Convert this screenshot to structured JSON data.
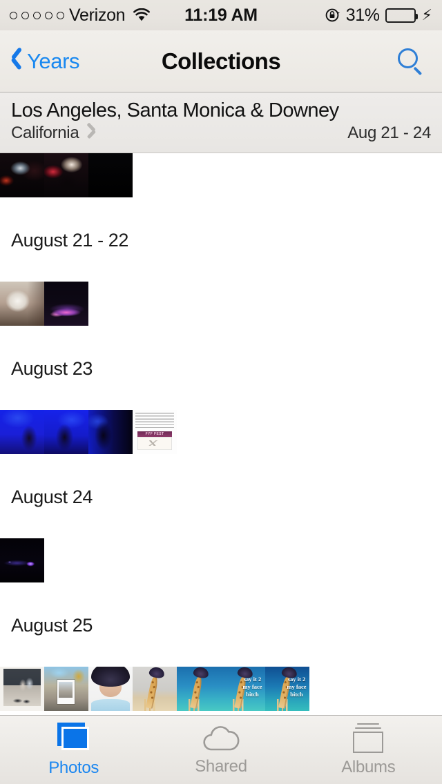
{
  "status_bar": {
    "signal_dots": 5,
    "carrier": "Verizon",
    "wifi_icon": "wifi-icon",
    "time": "11:19 AM",
    "rotation_lock_icon": "rotation-lock-icon",
    "battery_percent": "31%",
    "battery_fill_ratio": 0.31,
    "battery_color": "#4cd45e",
    "charging_icon": "lightning-bolt-icon"
  },
  "nav_bar": {
    "back_label": "Years",
    "back_icon": "chevron-left-icon",
    "title": "Collections",
    "search_icon": "search-icon",
    "accent_color": "#1988f0"
  },
  "collection_header": {
    "title": "Los Angeles, Santa Monica & Downey",
    "subtitle": "California",
    "disclosure_icon": "chevron-right-icon",
    "date_range": "Aug 21 - 24"
  },
  "sections": [
    {
      "heading": null,
      "clipped": true,
      "photos": [
        {
          "name": "concert-crowd-screen",
          "art": "ph-concert-a"
        },
        {
          "name": "concert-silhouette",
          "art": "ph-concert-b"
        },
        {
          "name": "black-frame",
          "art": "ph-black"
        }
      ]
    },
    {
      "heading": "August 21 - 22",
      "clipped": false,
      "photos": [
        {
          "name": "white-bucket-cup",
          "art": "ph-bucket"
        },
        {
          "name": "stage-pink-lights",
          "art": "ph-stage-pink"
        }
      ]
    },
    {
      "heading": "August 23",
      "clipped": false,
      "photos": [
        {
          "name": "blue-stage-1",
          "art": "ph-blue-a"
        },
        {
          "name": "blue-stage-2",
          "art": "ph-blue-b"
        },
        {
          "name": "blue-stage-3",
          "art": "ph-blue-c"
        },
        {
          "name": "fyf-fest-map-screenshot",
          "art": "ph-fyf",
          "overlay_text": "FYF FEST"
        }
      ]
    },
    {
      "heading": "August 24",
      "clipped": false,
      "photos": [
        {
          "name": "night-stage-purple",
          "art": "ph-night-stage"
        }
      ]
    },
    {
      "heading": "August 25",
      "clipped": false,
      "photos": [
        {
          "name": "pavement-people",
          "art": "ph-pavement"
        },
        {
          "name": "outdoor-crowd-polaroid",
          "art": "ph-crowd"
        },
        {
          "name": "bucket-hat-selfie",
          "art": "ph-hat-selfie"
        },
        {
          "name": "giraffe-hat-gray",
          "art": "ph-giraffe-gray"
        },
        {
          "name": "giraffe-hat-blue",
          "art": "ph-giraffe-blue"
        },
        {
          "name": "giraffe-hat-blue-text",
          "art": "ph-giraffe-blue",
          "overlay_text": "say it 2 my face bitch"
        },
        {
          "name": "giraffe-hat-blue-dark-text",
          "art": "ph-giraffe-blue-dark",
          "overlay_text": "say it 2 my face bitch"
        }
      ]
    }
  ],
  "tab_bar": {
    "tabs": [
      {
        "label": "Photos",
        "icon": "photos-stack-icon",
        "active": true
      },
      {
        "label": "Shared",
        "icon": "cloud-icon",
        "active": false
      },
      {
        "label": "Albums",
        "icon": "albums-book-icon",
        "active": false
      }
    ],
    "active_color": "#1a86f0",
    "inactive_color": "#9c9a97"
  }
}
